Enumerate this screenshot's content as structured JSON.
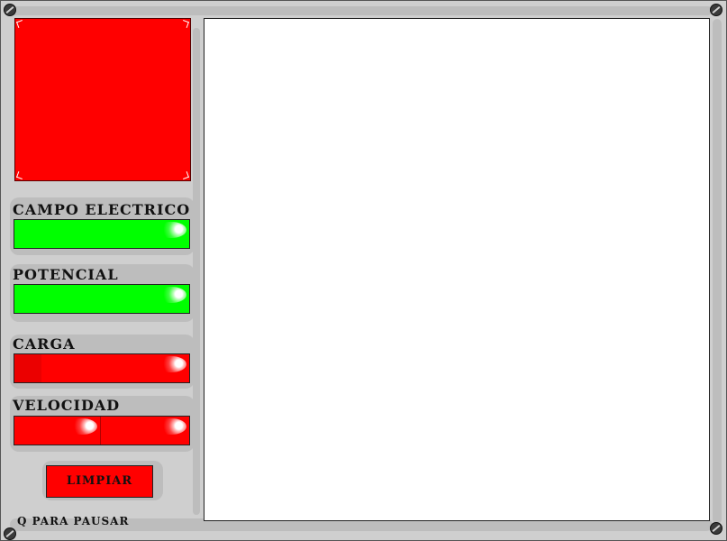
{
  "panel": {
    "campo_label": "CAMPO ELECTRICO",
    "potencial_label": "POTENCIAL",
    "carga_label": "CARGA",
    "velocidad_label": "VELOCIDAD",
    "limpiar_label": "LIMPIAR",
    "pause_hint": "Q PARA PAUSAR"
  },
  "colors": {
    "preview": "#ff0000",
    "campo_bar": "#00ff00",
    "potencial_bar": "#00ff00",
    "carga_bar": "#ff0000",
    "velocidad_bar": "#ff0000",
    "canvas": "#ffffff",
    "background": "#cfcfcf"
  }
}
